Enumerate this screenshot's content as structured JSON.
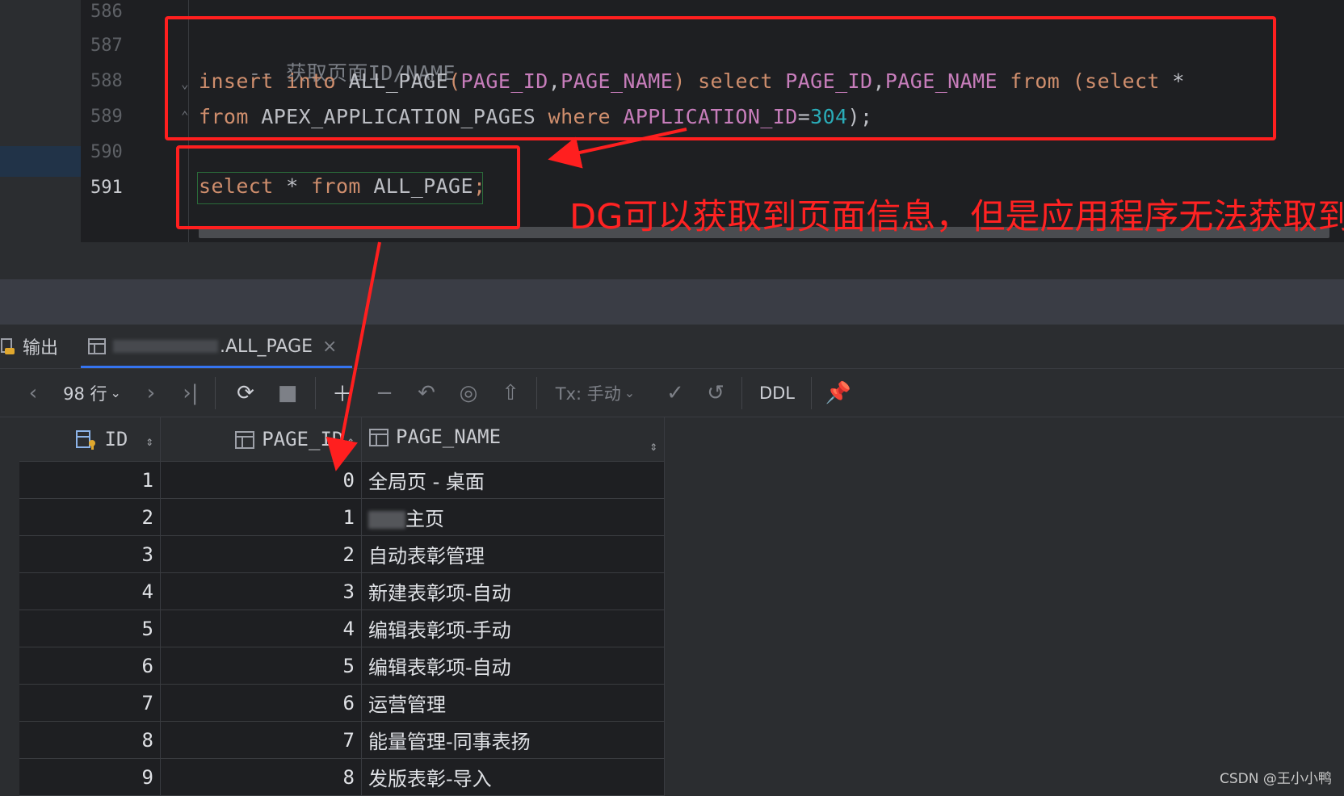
{
  "editor": {
    "line_numbers": [
      "586",
      "587",
      "588",
      "589",
      "590",
      "591"
    ],
    "comment_line": "-- 获取页面ID/NAME",
    "line588": {
      "insert": "insert",
      "into": "into",
      "table": "ALL_PAGE",
      "paren_open": "(",
      "col1": "PAGE_ID",
      "comma1": ",",
      "col2": "PAGE_NAME",
      "paren_close": ")",
      "select": "select",
      "col3": "PAGE_ID",
      "comma2": ",",
      "col4": "PAGE_NAME",
      "from": "from",
      "sub_open": "(",
      "sub_select": "select",
      "star": "*"
    },
    "line589": {
      "from": "from",
      "source": "APEX_APPLICATION_PAGES",
      "where": "where",
      "col": "APPLICATION_ID",
      "eq": "=",
      "value": "304",
      "end": ");"
    },
    "line591": {
      "select": "select",
      "star": "*",
      "from": "from",
      "table": "ALL_PAGE",
      "semi": ";"
    }
  },
  "annotation": "DG可以获取到页面信息，但是应用程序无法获取到",
  "tabs": {
    "output": "输出",
    "result_suffix": ".ALL_PAGE",
    "close": "×"
  },
  "toolbar": {
    "rows_label": "98 行",
    "tx_label": "Tx: 手动",
    "ddl_label": "DDL"
  },
  "grid": {
    "columns": [
      "ID",
      "PAGE_ID",
      "PAGE_NAME"
    ],
    "rows": [
      {
        "id": "1",
        "page_id": "0",
        "page_name": "全局页 - 桌面"
      },
      {
        "id": "2",
        "page_id": "1",
        "page_name": "主页"
      },
      {
        "id": "3",
        "page_id": "2",
        "page_name": "自动表彰管理"
      },
      {
        "id": "4",
        "page_id": "3",
        "page_name": "新建表彰项-自动"
      },
      {
        "id": "5",
        "page_id": "4",
        "page_name": "编辑表彰项-手动"
      },
      {
        "id": "6",
        "page_id": "5",
        "page_name": "编辑表彰项-自动"
      },
      {
        "id": "7",
        "page_id": "6",
        "page_name": "运营管理"
      },
      {
        "id": "8",
        "page_id": "7",
        "page_name": "能量管理-同事表扬"
      },
      {
        "id": "9",
        "page_id": "8",
        "page_name": "发版表彰-导入"
      }
    ]
  },
  "watermark": "CSDN @王小小鸭",
  "colors": {
    "annotation_red": "#ff1f1f",
    "keyword": "#cf8e6d",
    "column": "#c77dbb",
    "number": "#2aacb8",
    "tab_underline": "#3574f0"
  }
}
